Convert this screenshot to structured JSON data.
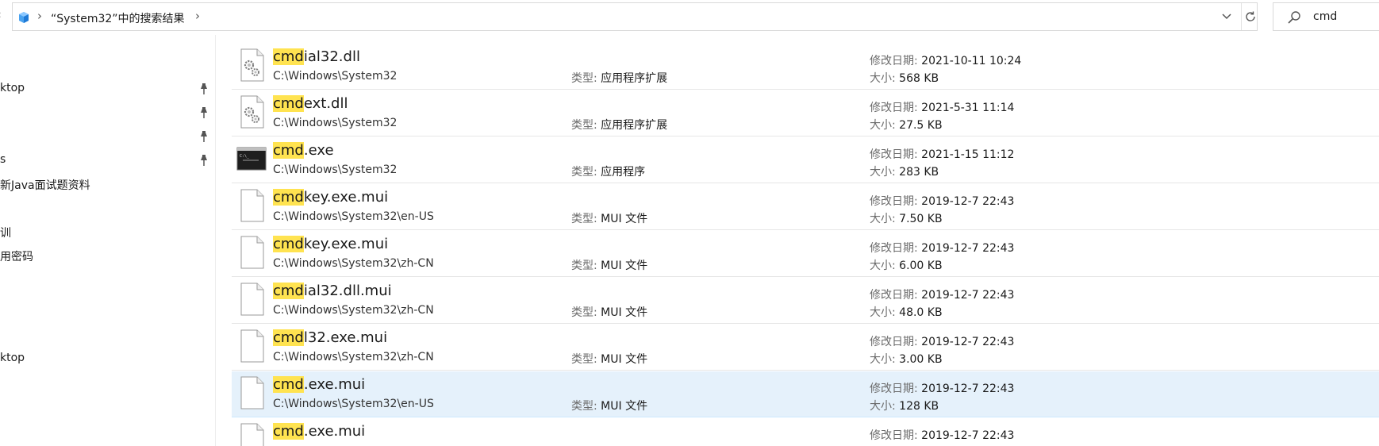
{
  "address_bar": {
    "breadcrumb_text": "“System32”中的搜索结果",
    "search_value": "cmd"
  },
  "nav_pane": {
    "items": [
      {
        "label": "ktop",
        "pinned": true
      },
      {
        "label": "",
        "pinned": true
      },
      {
        "label": "",
        "pinned": true
      },
      {
        "label": "s",
        "pinned": true
      },
      {
        "label": "新Java面试题资料",
        "pinned": false
      },
      {
        "label": "",
        "pinned": false
      },
      {
        "label": "训",
        "pinned": false
      },
      {
        "label": "用密码",
        "pinned": false
      },
      {
        "label": "ktop",
        "pinned": false
      }
    ]
  },
  "columns_labels": {
    "type": "类型: ",
    "modified": "修改日期: ",
    "size": "大小: "
  },
  "results": [
    {
      "match": "cmd",
      "rest": "ial32.dll",
      "path": "C:\\Windows\\System32",
      "type": "应用程序扩展",
      "modified": "2021-10-11 10:24",
      "size": "568 KB",
      "icon": "gear-file-icon",
      "selected": false
    },
    {
      "match": "cmd",
      "rest": "ext.dll",
      "path": "C:\\Windows\\System32",
      "type": "应用程序扩展",
      "modified": "2021-5-31 11:14",
      "size": "27.5 KB",
      "icon": "gear-file-icon",
      "selected": false
    },
    {
      "match": "cmd",
      "rest": ".exe",
      "path": "C:\\Windows\\System32",
      "type": "应用程序",
      "modified": "2021-1-15 11:12",
      "size": "283 KB",
      "icon": "console-app-icon",
      "selected": false
    },
    {
      "match": "cmd",
      "rest": "key.exe.mui",
      "path": "C:\\Windows\\System32\\en-US",
      "type": "MUI 文件",
      "modified": "2019-12-7 22:43",
      "size": "7.50 KB",
      "icon": "blank-file-icon",
      "selected": false
    },
    {
      "match": "cmd",
      "rest": "key.exe.mui",
      "path": "C:\\Windows\\System32\\zh-CN",
      "type": "MUI 文件",
      "modified": "2019-12-7 22:43",
      "size": "6.00 KB",
      "icon": "blank-file-icon",
      "selected": false
    },
    {
      "match": "cmd",
      "rest": "ial32.dll.mui",
      "path": "C:\\Windows\\System32\\zh-CN",
      "type": "MUI 文件",
      "modified": "2019-12-7 22:43",
      "size": "48.0 KB",
      "icon": "blank-file-icon",
      "selected": false
    },
    {
      "match": "cmd",
      "rest": "l32.exe.mui",
      "path": "C:\\Windows\\System32\\zh-CN",
      "type": "MUI 文件",
      "modified": "2019-12-7 22:43",
      "size": "3.00 KB",
      "icon": "blank-file-icon",
      "selected": false
    },
    {
      "match": "cmd",
      "rest": ".exe.mui",
      "path": "C:\\Windows\\System32\\en-US",
      "type": "MUI 文件",
      "modified": "2019-12-7 22:43",
      "size": "128 KB",
      "icon": "blank-file-icon",
      "selected": true
    },
    {
      "match": "cmd",
      "rest": ".exe.mui",
      "path": "",
      "type": "",
      "modified": "2019-12-7 22:43",
      "size": "",
      "icon": "blank-file-icon",
      "selected": false
    }
  ]
}
